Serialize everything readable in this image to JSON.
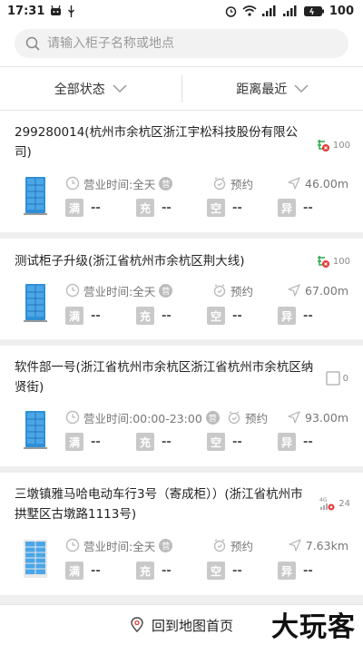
{
  "statusbar": {
    "time": "17:31",
    "battery": "100"
  },
  "search": {
    "placeholder": "请输入柜子名称或地点"
  },
  "filters": {
    "status": "全部状态",
    "sort": "距离最近"
  },
  "labels": {
    "full": "满",
    "charging": "充",
    "empty": "空",
    "abnormal": "异",
    "reserve": "预约",
    "dash": "--"
  },
  "cards": [
    {
      "title": "299280014(杭州市余杭区浙江宇松科技股份有限公司)",
      "hours": "营业时间:全天",
      "distance": "46.00m",
      "signal": "100"
    },
    {
      "title": "测试柜子升级(浙江省杭州市余杭区荆大线)",
      "hours": "营业时间:全天",
      "distance": "67.00m",
      "signal": "100"
    },
    {
      "title": "软件部一号(浙江省杭州市余杭区浙江省杭州市余杭区纳贤街)",
      "hours": "营业时间:00:00-23:00",
      "distance": "93.00m",
      "signal": "0"
    },
    {
      "title": "三墩镇雅马哈电动车行3号（寄成柜））(浙江省杭州市拱墅区古墩路1113号)",
      "hours": "营业时间:全天",
      "distance": "7.63km",
      "signal": "24"
    }
  ],
  "bottom": {
    "label": "回到地图首页"
  },
  "watermark": "大玩客",
  "colors": {
    "signal_green": "#2fa84f",
    "signal_red": "#e53935",
    "cabinet_blue": "#2f8fd6"
  }
}
